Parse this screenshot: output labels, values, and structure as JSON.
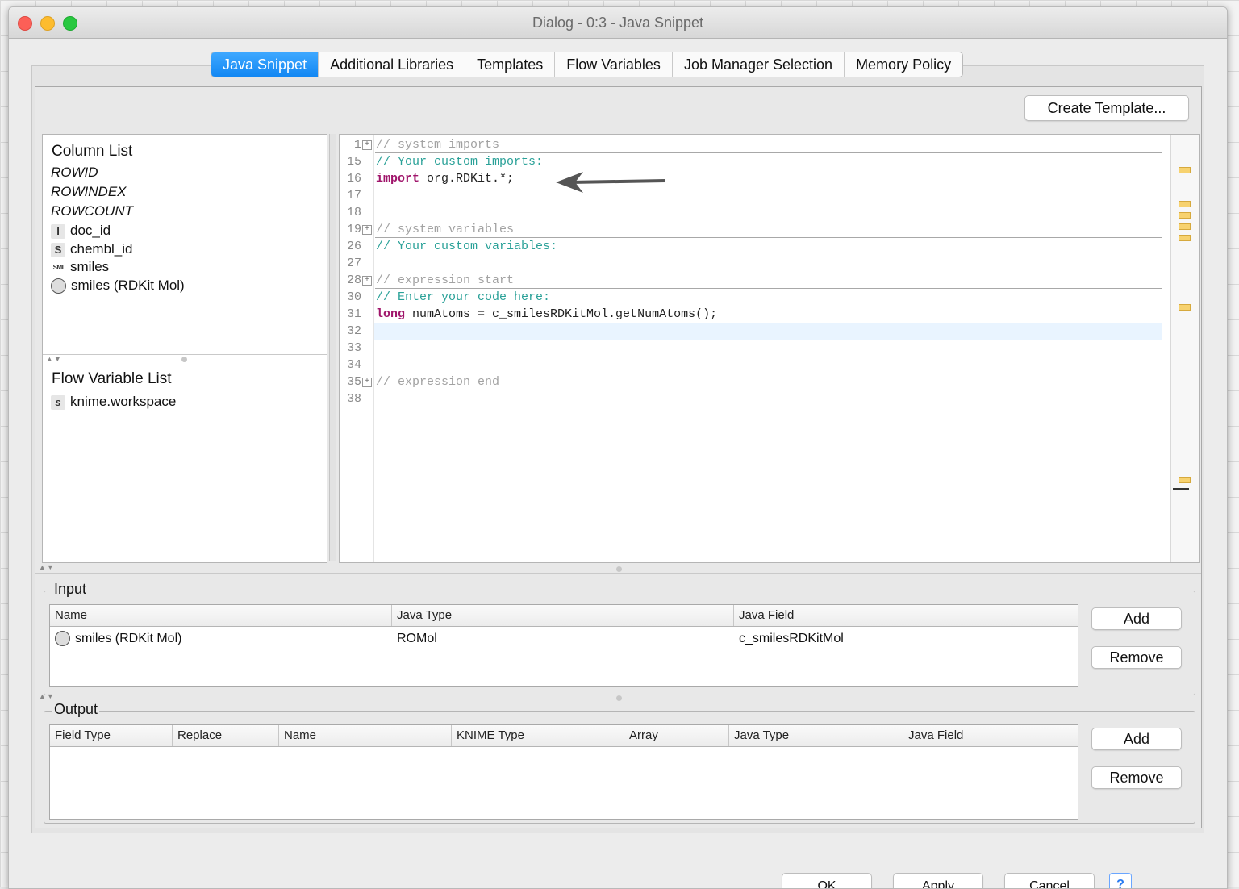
{
  "window": {
    "title": "Dialog - 0:3 - Java Snippet"
  },
  "tabs": [
    {
      "label": "Java Snippet",
      "active": true
    },
    {
      "label": "Additional Libraries"
    },
    {
      "label": "Templates"
    },
    {
      "label": "Flow Variables"
    },
    {
      "label": "Job Manager Selection"
    },
    {
      "label": "Memory Policy"
    }
  ],
  "toolbar": {
    "create_template_label": "Create Template..."
  },
  "column_list": {
    "header": "Column List",
    "items": [
      {
        "label": "ROWID",
        "icon": "none"
      },
      {
        "label": "ROWINDEX",
        "icon": "none"
      },
      {
        "label": "ROWCOUNT",
        "icon": "none"
      },
      {
        "label": "doc_id",
        "icon": "integer-type-icon",
        "glyph": "I"
      },
      {
        "label": "chembl_id",
        "icon": "string-type-icon",
        "glyph": "S"
      },
      {
        "label": "smiles",
        "icon": "smiles-type-icon",
        "glyph": "SMI"
      },
      {
        "label": "smiles (RDKit Mol)",
        "icon": "rdkit-mol-type-icon",
        "glyph": ""
      }
    ]
  },
  "flow_variable_list": {
    "header": "Flow Variable List",
    "items": [
      {
        "label": "knime.workspace",
        "icon": "string-flow-variable-icon",
        "glyph": "s"
      }
    ]
  },
  "editor": {
    "lines": [
      {
        "n": "1",
        "fold": true,
        "text": "// system imports",
        "style": "sys"
      },
      {
        "n": "15",
        "text": "// Your custom imports:",
        "style": "cm"
      },
      {
        "n": "16",
        "kw": "import",
        "text": " org.RDKit.*;",
        "style": "tx"
      },
      {
        "n": "17",
        "text": "",
        "style": "tx"
      },
      {
        "n": "18",
        "text": "",
        "style": "tx"
      },
      {
        "n": "19",
        "fold": true,
        "text": "// system variables",
        "style": "sys"
      },
      {
        "n": "26",
        "text": "// Your custom variables:",
        "style": "cm"
      },
      {
        "n": "27",
        "text": "",
        "style": "tx"
      },
      {
        "n": "28",
        "fold": true,
        "text": "// expression start",
        "style": "sys"
      },
      {
        "n": "30",
        "text": "// Enter your code here:",
        "style": "cm"
      },
      {
        "n": "31",
        "kw": "long",
        "text": " numAtoms = c_smilesRDKitMol.getNumAtoms();",
        "style": "tx"
      },
      {
        "n": "32",
        "text": "",
        "style": "tx"
      },
      {
        "n": "33",
        "text": "",
        "style": "tx"
      },
      {
        "n": "34",
        "text": "",
        "style": "tx"
      },
      {
        "n": "35",
        "fold": true,
        "text": "// expression end",
        "style": "sys"
      },
      {
        "n": "38",
        "text": "",
        "style": "tx"
      }
    ]
  },
  "input": {
    "title": "Input",
    "columns": [
      "Name",
      "Java Type",
      "Java Field"
    ],
    "rows": [
      {
        "name": "smiles (RDKit Mol)",
        "java_type": "ROMol",
        "java_field": "c_smilesRDKitMol"
      }
    ],
    "add_label": "Add",
    "remove_label": "Remove"
  },
  "output": {
    "title": "Output",
    "columns": [
      "Field Type",
      "Replace",
      "Name",
      "KNIME Type",
      "Array",
      "Java Type",
      "Java Field"
    ],
    "rows": [],
    "add_label": "Add",
    "remove_label": "Remove"
  },
  "footer": {
    "ok_label": "OK",
    "apply_label": "Apply",
    "cancel_label": "Cancel",
    "help_glyph": "?"
  },
  "colors": {
    "active_tab": "#1287f3",
    "comment": "#2aa198",
    "keyword": "#a0156b",
    "overview_marker": "#f7d26f"
  }
}
